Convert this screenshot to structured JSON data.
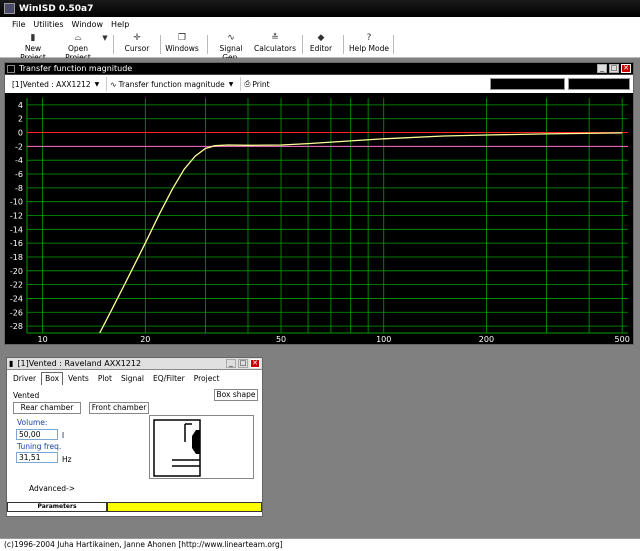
{
  "app": {
    "title": "WinISD 0.50a7"
  },
  "menu": [
    "File",
    "Utilities",
    "Window",
    "Help"
  ],
  "toolbar": {
    "new_project": "New Project",
    "open_project": "Open Project",
    "cursor": "Cursor",
    "windows": "Windows",
    "signal_gen": "Signal Gen.",
    "calculators": "Calculators",
    "editor": "Editor",
    "help_mode": "Help Mode"
  },
  "tf": {
    "title": "Transfer function magnitude",
    "project": "[1]Vented : AXX1212",
    "plot_type": "Transfer function magnitude",
    "print": "Print"
  },
  "driver": {
    "title": "[1]Vented : Raveland AXX1212",
    "tabs": [
      "Driver",
      "Box",
      "Vents",
      "Plot",
      "Signal",
      "EQ/Filter",
      "Project"
    ],
    "active_tab": "Box",
    "type": "Vented",
    "box_shape": "Box shape",
    "rear_chamber": "Rear chamber",
    "front_chamber": "Front chamber",
    "volume_label": "Volume:",
    "volume_value": "50,00",
    "volume_unit": "l",
    "tuning_label": "Tuning freq.",
    "tuning_value": "31,51",
    "tuning_unit": "Hz",
    "advanced": "Advanced->",
    "params": "Parameters"
  },
  "status": "(c)1996-2004 Juha Hartikainen, Janne Ahonen [http://www.linearteam.org]",
  "colors": {
    "grid": "#00a000",
    "curve": "#ffff99",
    "ref_red": "#ff2020",
    "ref_pink": "#ff66cc",
    "axis_text": "#ffffff"
  },
  "chart_data": {
    "type": "line",
    "title": "",
    "xlabel": "",
    "ylabel": "",
    "xscale": "log",
    "xlim": [
      9,
      520
    ],
    "ylim": [
      -29,
      5
    ],
    "xticks": [
      10,
      20,
      50,
      100,
      200,
      500
    ],
    "yticks": [
      4,
      2,
      0,
      -2,
      -4,
      -6,
      -8,
      -10,
      -12,
      -14,
      -16,
      -18,
      -20,
      -22,
      -24,
      -26,
      -28
    ],
    "reference_lines": [
      {
        "y": 0,
        "color": "#ff2020"
      },
      {
        "y": -2,
        "color": "#ff66cc"
      }
    ],
    "series": [
      {
        "x": [
          14.7,
          16,
          18,
          20,
          22,
          24,
          26,
          28,
          30,
          32,
          35,
          40,
          50,
          60,
          80,
          100,
          150,
          200,
          300,
          500
        ],
        "y": [
          -29,
          -25.5,
          -20.5,
          -16,
          -11.8,
          -8.2,
          -5.3,
          -3.4,
          -2.3,
          -1.9,
          -1.8,
          -1.85,
          -1.8,
          -1.6,
          -1.2,
          -0.9,
          -0.5,
          -0.35,
          -0.2,
          -0.05
        ]
      }
    ]
  }
}
